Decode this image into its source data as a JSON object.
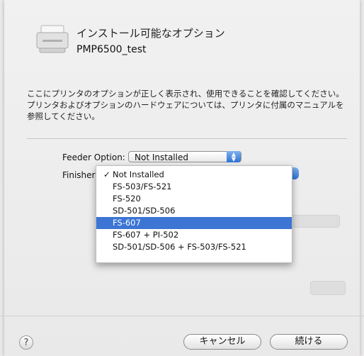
{
  "dialog": {
    "title": "インストール可能なオプション",
    "printer_name": "PMP6500_test",
    "description": "ここにプリンタのオプションが正しく表示され、使用できることを確認してください。プリンタおよびオプションのハードウェアについては、プリンタに付属のマニュアルを参照してください。"
  },
  "options": {
    "feeder_label": "Feeder Option:",
    "feeder_value": "Not Installed",
    "finisher_label": "Finisher"
  },
  "menu": {
    "items": [
      {
        "label": "Not Installed",
        "checked": true
      },
      {
        "label": "FS-503/FS-521"
      },
      {
        "label": "FS-520"
      },
      {
        "label": "SD-501/SD-506"
      },
      {
        "label": "FS-607",
        "selected": true
      },
      {
        "label": "FS-607 + PI-502"
      },
      {
        "label": "SD-501/SD-506 + FS-503/FS-521"
      }
    ],
    "check_mark": "✓"
  },
  "footer": {
    "help": "?",
    "cancel": "キャンセル",
    "continue": "続ける"
  },
  "colors": {
    "selection": "#3c75d4",
    "popup_arrow": "#2f72d6"
  }
}
